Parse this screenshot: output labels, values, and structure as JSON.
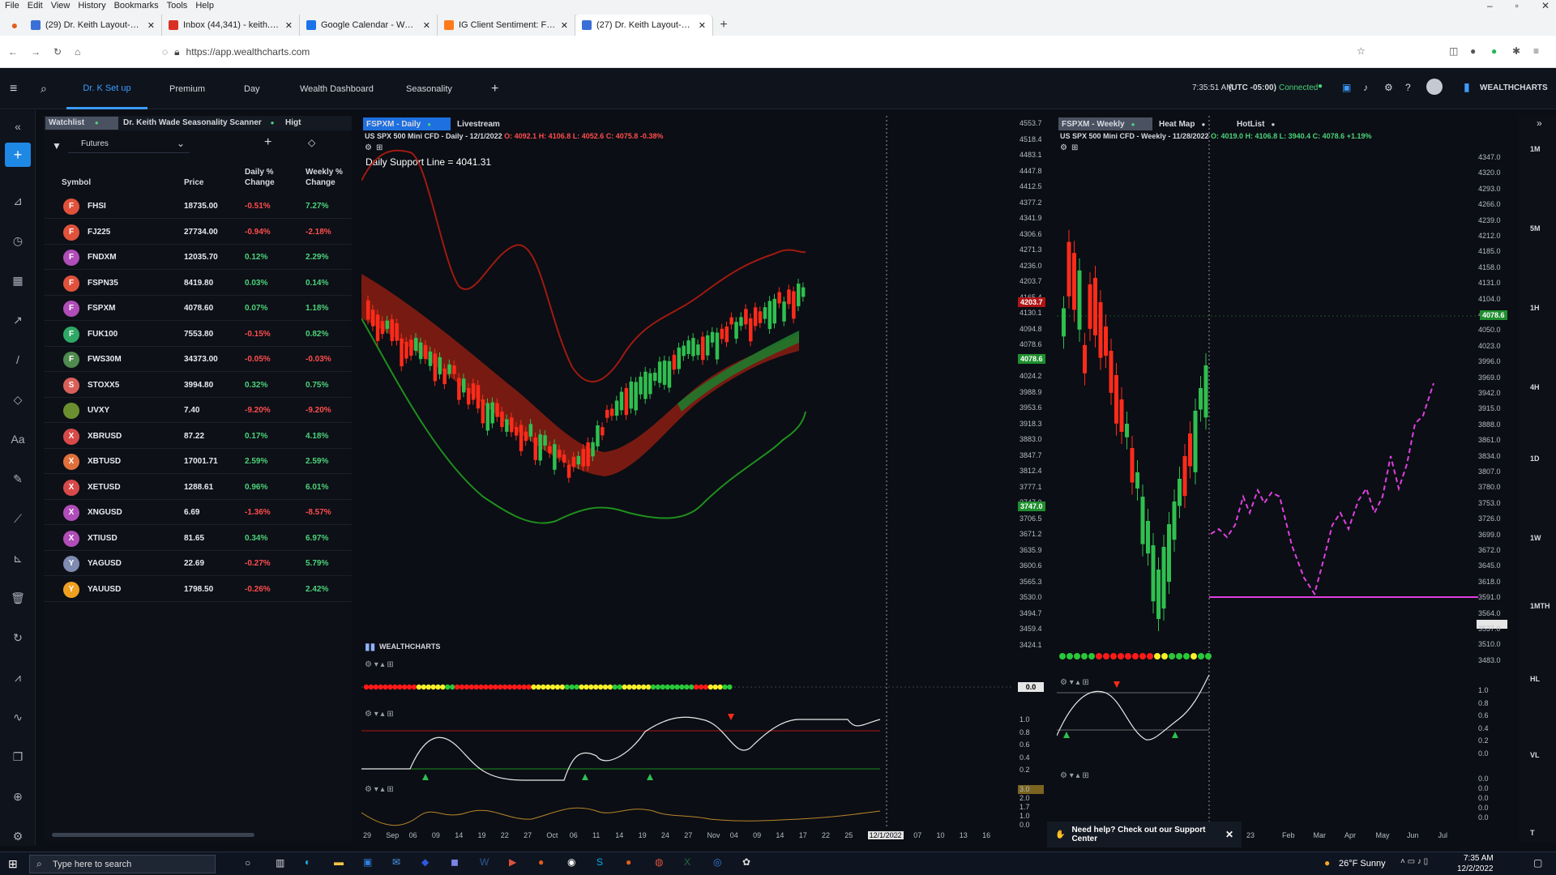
{
  "browser": {
    "menu": [
      "File",
      "Edit",
      "View",
      "History",
      "Bookmarks",
      "Tools",
      "Help"
    ],
    "tabs": [
      {
        "label": "(29) Dr. Keith Layout-Seasonali",
        "color": "#3b6fd8",
        "active": false
      },
      {
        "label": "Inbox (44,341) - keith.wade.dba",
        "color": "#d93025",
        "active": false
      },
      {
        "label": "Google Calendar - Week of Nov",
        "color": "#1a73e8",
        "active": false
      },
      {
        "label": "IG Client Sentiment: Forex Trad",
        "color": "#ff7a1a",
        "active": false
      },
      {
        "label": "(27) Dr. Keith Layout-Seasonali",
        "color": "#3b6fd8",
        "active": true
      }
    ],
    "url": "https://app.wealthcharts.com"
  },
  "app": {
    "tabs": [
      "Dr. K Set up",
      "Premium",
      "Day",
      "Wealth Dashboard",
      "Seasonality"
    ],
    "add": "+",
    "time": "7:35:51 AM",
    "timezone": "(UTC -05:00)",
    "status": "Connected",
    "brand": "WEALTHCHARTS"
  },
  "watchlist": {
    "tabs": [
      "Watchlist",
      "Dr. Keith Wade Seasonality Scanner",
      "Higt"
    ],
    "filter": "Futures",
    "headers": [
      "Symbol",
      "Price",
      "Daily % Change",
      "Weekly % Change"
    ],
    "rows": [
      {
        "avatar": "F",
        "color": "#e0523b",
        "symbol": "FHSI",
        "price": "18735.00",
        "daily": "-0.51%",
        "weekly": "7.27%"
      },
      {
        "avatar": "F",
        "color": "#e0523b",
        "symbol": "FJ225",
        "price": "27734.00",
        "daily": "-0.94%",
        "weekly": "-2.18%"
      },
      {
        "avatar": "F",
        "color": "#b04db8",
        "symbol": "FNDXM",
        "price": "12035.70",
        "daily": "0.12%",
        "weekly": "2.29%"
      },
      {
        "avatar": "F",
        "color": "#e0523b",
        "symbol": "FSPN35",
        "price": "8419.80",
        "daily": "0.03%",
        "weekly": "0.14%"
      },
      {
        "avatar": "F",
        "color": "#b04db8",
        "symbol": "FSPXM",
        "price": "4078.60",
        "daily": "0.07%",
        "weekly": "1.18%"
      },
      {
        "avatar": "F",
        "color": "#2fa866",
        "symbol": "FUK100",
        "price": "7553.80",
        "daily": "-0.15%",
        "weekly": "0.82%"
      },
      {
        "avatar": "F",
        "color": "#4f8a4f",
        "symbol": "FWS30M",
        "price": "34373.00",
        "daily": "-0.05%",
        "weekly": "-0.03%"
      },
      {
        "avatar": "S",
        "color": "#d9605a",
        "symbol": "STOXX5",
        "price": "3994.80",
        "daily": "0.32%",
        "weekly": "0.75%"
      },
      {
        "avatar": "",
        "color": "#6b8f2f",
        "symbol": "UVXY",
        "price": "7.40",
        "daily": "-9.20%",
        "weekly": "-9.20%"
      },
      {
        "avatar": "X",
        "color": "#d84a4a",
        "symbol": "XBRUSD",
        "price": "87.22",
        "daily": "0.17%",
        "weekly": "4.18%"
      },
      {
        "avatar": "X",
        "color": "#e0703b",
        "symbol": "XBTUSD",
        "price": "17001.71",
        "daily": "2.59%",
        "weekly": "2.59%"
      },
      {
        "avatar": "X",
        "color": "#d84a4a",
        "symbol": "XETUSD",
        "price": "1288.61",
        "daily": "0.96%",
        "weekly": "6.01%"
      },
      {
        "avatar": "X",
        "color": "#b04db8",
        "symbol": "XNGUSD",
        "price": "6.69",
        "daily": "-1.36%",
        "weekly": "-8.57%"
      },
      {
        "avatar": "X",
        "color": "#b04db8",
        "symbol": "XTIUSD",
        "price": "81.65",
        "daily": "0.34%",
        "weekly": "6.97%"
      },
      {
        "avatar": "Y",
        "color": "#7f8bb0",
        "symbol": "YAGUSD",
        "price": "22.69",
        "daily": "-0.27%",
        "weekly": "5.79%"
      },
      {
        "avatar": "Y",
        "color": "#f0a020",
        "symbol": "YAUUSD",
        "price": "1798.50",
        "daily": "-0.26%",
        "weekly": "2.42%"
      }
    ]
  },
  "chart_daily": {
    "tabs": [
      "FSPXM - Daily",
      "Livestream"
    ],
    "symbol": "US SPX 500 Mini CFD",
    "timeframe": "Daily",
    "date": "12/1/2022",
    "o": "O: 4092.1",
    "h": "H: 4106.8",
    "l": "L: 4052.6",
    "c": "C: 4075.8",
    "change": "-0.38%",
    "annotation": "Daily Support Line = 4041.31",
    "watermark": "WEALTHCHARTS",
    "price_axis": [
      "4553.7",
      "4518.4",
      "4483.1",
      "4447.8",
      "4412.5",
      "4377.2",
      "4341.9",
      "4306.6",
      "4271.3",
      "4236.0",
      "4203.7",
      "4165.4",
      "4130.1",
      "4094.8",
      "4078.6",
      "4059.5",
      "4024.2",
      "3988.9",
      "3953.6",
      "3918.3",
      "3883.0",
      "3847.7",
      "3812.4",
      "3777.1",
      "3747.0",
      "3706.5",
      "3671.2",
      "3635.9",
      "3600.6",
      "3565.3",
      "3530.0",
      "3494.7",
      "3459.4",
      "3424.1"
    ],
    "tag_red": "4203.7",
    "tag_green1": "4078.6",
    "tag_green2": "3747.0",
    "tag_zero": "0.0",
    "osc_axis": [
      "1.0",
      "0.8",
      "0.6",
      "0.4",
      "0.2"
    ],
    "vol_axis": [
      "3.0",
      "2.0",
      "1.7",
      "1.0",
      "0.0"
    ],
    "date_axis": [
      "29",
      "Sep",
      "06",
      "09",
      "14",
      "19",
      "22",
      "27",
      "Oct",
      "06",
      "11",
      "14",
      "19",
      "24",
      "27",
      "Nov",
      "04",
      "09",
      "14",
      "17",
      "22",
      "25",
      "12/1/2022",
      "04",
      "07",
      "10",
      "13",
      "16"
    ]
  },
  "chart_weekly": {
    "tabs": [
      "FSPXM - Weekly",
      "Heat Map",
      "HotList"
    ],
    "symbol": "US SPX 500 Mini CFD",
    "timeframe": "Weekly",
    "date": "11/28/2022",
    "o": "O: 4019.0",
    "h": "H: 4106.8",
    "l": "L: 3940.4",
    "c": "C: 4078.6",
    "change": "+1.19%",
    "price_axis": [
      "4347.0",
      "4320.0",
      "4293.0",
      "4266.0",
      "4239.0",
      "4212.0",
      "4185.0",
      "4158.0",
      "4131.0",
      "4104.0",
      "4078.6",
      "4050.0",
      "4023.0",
      "3996.0",
      "3969.0",
      "3942.0",
      "3915.0",
      "3888.0",
      "3861.0",
      "3834.0",
      "3807.0",
      "3780.0",
      "3753.0",
      "3726.0",
      "3699.0",
      "3672.0",
      "3645.0",
      "3618.0",
      "3591.0",
      "3564.0",
      "3537.0",
      "3510.0",
      "3483.0"
    ],
    "tag": "4078.6",
    "osc_axis": [
      "1.0",
      "0.8",
      "0.6",
      "0.4",
      "0.2",
      "0.0"
    ],
    "low_axis": [
      "0.0",
      "0.0",
      "0.0",
      "0.0",
      "0.0"
    ],
    "month_axis": [
      "Feb",
      "Mar",
      "Apr",
      "May",
      "Jun",
      "Jul"
    ],
    "partial_label": "23"
  },
  "timeframes": [
    "1M",
    "5M",
    "1H",
    "4H",
    "1D",
    "1W",
    "1MTH",
    "HL",
    "VL",
    "T"
  ],
  "help": {
    "text": "Need help? Check out our Support Center"
  },
  "taskbar": {
    "search": "Type here to search",
    "weather": "26°F Sunny",
    "time": "7:35 AM",
    "date": "12/2/2022"
  },
  "colors": {
    "accent": "#3b9cff",
    "up": "#2fbf4f",
    "down": "#ff2b1a",
    "magenta": "#e040e0"
  }
}
